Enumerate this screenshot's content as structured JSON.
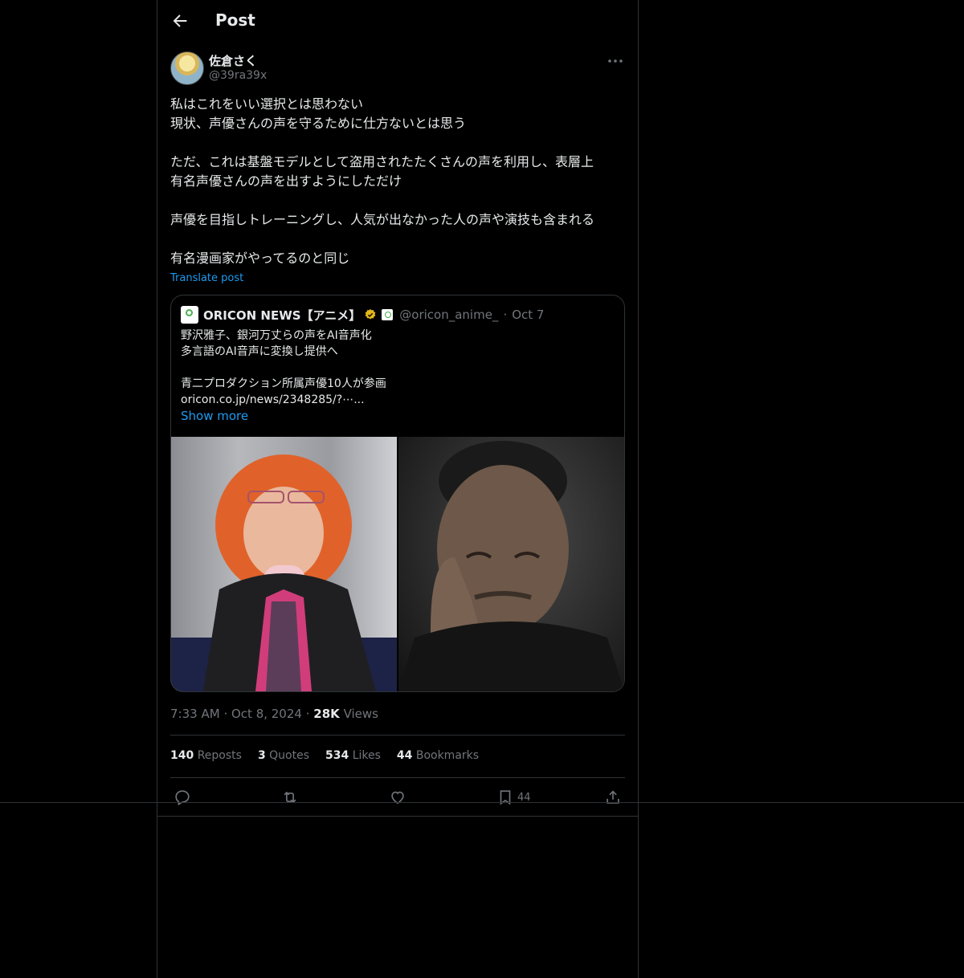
{
  "header": {
    "title": "Post"
  },
  "author": {
    "name": "佐倉さく",
    "handle": "@39ra39x"
  },
  "post": {
    "lines": [
      "私はこれをいい選択とは思わない",
      "現状、声優さんの声を守るために仕方ないとは思う",
      "",
      "ただ、これは基盤モデルとして盗用されたたくさんの声を利用し、表層上",
      "有名声優さんの声を出すようにしただけ",
      "",
      "声優を目指しトレーニングし、人気が出なかった人の声や演技も含まれる",
      "",
      "有名漫画家がやってるのと同じ"
    ],
    "translate_label": "Translate post"
  },
  "quote": {
    "name": "ORICON NEWS【アニメ】",
    "handle": "@oricon_anime_",
    "date": "Oct 7",
    "lines": [
      "野沢雅子、銀河万丈らの声をAI音声化",
      "多言語のAI音声に変換し提供へ",
      "",
      "青二プロダクション所属声優10人が参画",
      "oricon.co.jp/news/2348285/?⋯..."
    ],
    "show_more": "Show more"
  },
  "meta": {
    "time": "7:33 AM",
    "date": "Oct 8, 2024",
    "views_count": "28K",
    "views_label": "Views"
  },
  "stats": {
    "reposts_count": "140",
    "reposts_label": "Reposts",
    "quotes_count": "3",
    "quotes_label": "Quotes",
    "likes_count": "534",
    "likes_label": "Likes",
    "bookmarks_count": "44",
    "bookmarks_label": "Bookmarks"
  },
  "actions": {
    "bookmark_count": "44"
  },
  "colors": {
    "background": "#000000",
    "border": "#2f3336",
    "link": "#1d9bf0",
    "muted": "#71767b",
    "text": "#e7e9ea"
  },
  "icons": [
    "back-arrow-icon",
    "more-icon",
    "verified-badge-icon",
    "reply-icon",
    "repost-icon",
    "like-icon",
    "bookmark-icon",
    "share-icon"
  ]
}
